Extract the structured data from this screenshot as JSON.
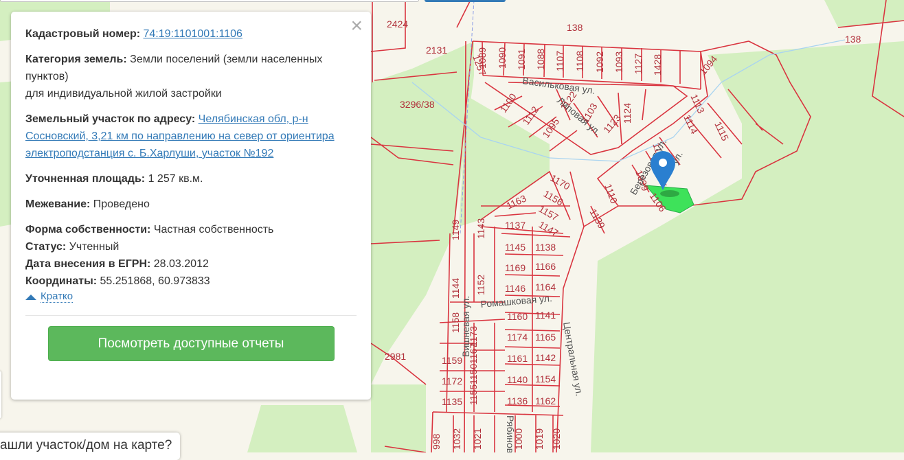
{
  "info": {
    "cadastral_label": "Кадастровый номер:",
    "cadastral_value": "74:19:1101001:1106",
    "category_label": "Категория земель:",
    "category_value": "Земли поселений (земли населенных пунктов)",
    "category_use": "для индивидуальной жилой застройки",
    "address_label": "Земельный участок по адресу:",
    "address_value": "Челябинская обл, р-н Сосновский, 3,21 км по направлению на север от ориентира электроподстанция с. Б.Харлуши, участок №192",
    "area_label": "Уточненная площадь:",
    "area_value": "1 257 кв.м.",
    "survey_label": "Межевание:",
    "survey_value": "Проведено",
    "ownership_label": "Форма собственности:",
    "ownership_value": "Частная собственность",
    "status_label": "Статус:",
    "status_value": "Учтенный",
    "date_label": "Дата внесения в ЕГРН:",
    "date_value": "28.03.2012",
    "coords_label": "Координаты:",
    "coords_value": "55.251868, 60.973833",
    "toggle_label": "Кратко",
    "reports_button": "Посмотреть доступные отчеты",
    "close_icon": "×"
  },
  "bottom_prompt": "ашли участок/дом на карте?",
  "map": {
    "streets": [
      "Васильковая ул.",
      "Липовая ул.",
      "Ромашковая ул.",
      "Центральная ул.",
      "Березовая ул.",
      "ул.",
      "Вишневая ул.",
      "Рябиновая ул."
    ],
    "parcels": [
      "2424",
      "138",
      "138",
      "2131",
      "3296/38",
      "1257",
      "1089",
      "1090",
      "1091",
      "1088",
      "1107",
      "1108",
      "1092",
      "1093",
      "1127",
      "1428",
      "1094",
      "1100",
      "1112",
      "1095",
      "1122",
      "1103",
      "1123",
      "1124",
      "1113",
      "1114",
      "1118",
      "1115",
      "1099",
      "1110",
      "1106",
      "1170",
      "1156",
      "1163",
      "1157",
      "1147",
      "1137",
      "1139",
      "1149",
      "1143",
      "1145",
      "1138",
      "1169",
      "1166",
      "1144",
      "1152",
      "1146",
      "1164",
      "1158",
      "1160",
      "1141",
      "1174",
      "1165",
      "1173",
      "1159",
      "1167",
      "1161",
      "1142",
      "1172",
      "1150",
      "1140",
      "1154",
      "1135",
      "1155",
      "1136",
      "1162",
      "998",
      "1032",
      "1021",
      "1000",
      "1019",
      "1020",
      "2981"
    ],
    "colors": {
      "parcel_line": "#d9343f",
      "forest": "#d4efc0",
      "selected": "#3ee25a",
      "marker": "#2a7fd0"
    }
  }
}
